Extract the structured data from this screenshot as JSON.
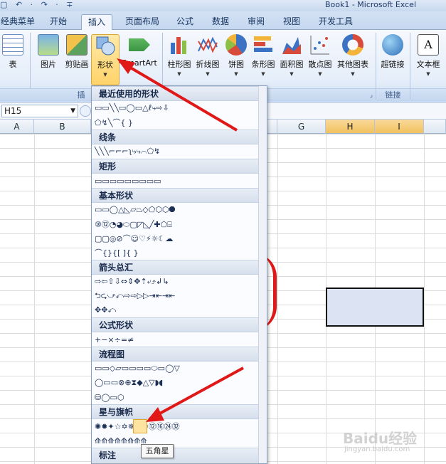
{
  "window": {
    "title": "Book1 - Microsoft Excel",
    "qat": "▢ ↶ · ↷ · ∓"
  },
  "tabs": [
    "经典菜单",
    "开始",
    "插入",
    "页面布局",
    "公式",
    "数据",
    "审阅",
    "视图",
    "开发工具"
  ],
  "ribbon": {
    "buttons": [
      "表",
      "图片",
      "剪贴画",
      "形状",
      "SmartArt",
      "柱形图",
      "折线图",
      "饼图",
      "条形图",
      "面积图",
      "散点图",
      "其他图表",
      "超链接",
      "文本框"
    ],
    "groups": [
      "插",
      "链接"
    ]
  },
  "formula": {
    "namebox": "H15"
  },
  "columns": [
    "A",
    "B",
    "G",
    "H",
    "I"
  ],
  "gallery": {
    "sections": [
      {
        "title": "最近使用的形状",
        "rows": [
          "▭▭╲╲▭◯▭△ℓ⤷⇨⇩",
          "⬠↯╲⌒{ }"
        ]
      },
      {
        "title": "线条",
        "rows": [
          "╲╲╲⌐⌐⌐ʅ⤷⤷⌒⬠↯"
        ]
      },
      {
        "title": "矩形",
        "rows": [
          "▭▭▭▭▭▭▭▭▭"
        ]
      },
      {
        "title": "基本形状",
        "rows": [
          "▭▭◯△◺▱⏢◇⬠⬡⬡⯃",
          "⑩⑫◔◕⬭▢◸◺╱✚⬠⌸",
          "▢▢◎⊘⌒☺♡⚡☼☾☁",
          "⌒{}{[ ]{ }"
        ]
      },
      {
        "title": "箭头总汇",
        "rows": [
          "⇨⇦⇧⇩⇔⇕✥⇡⤶⤴↲↳",
          "⮌⮎⤻⤺⇨⇨▷▷⇥⇤⇥⇤",
          "✥✥⤺"
        ]
      },
      {
        "title": "公式形状",
        "rows": [
          "+−×÷=≠"
        ]
      },
      {
        "title": "流程图",
        "rows": [
          "▭▭◇▱▭▭▭▭⬭▭◯▽",
          "◯▭▭⊗⊕⧗◆△▽◗◖",
          "⛁◯▭⬡"
        ]
      },
      {
        "title": "星与旗帜",
        "rows": [
          "✺✹✦☆✡✵⑧⑩⑫⑯㉔㉜",
          "⟰⟰⟰⟰⟰⟰⟰⟰"
        ]
      },
      {
        "title": "标注",
        "rows": []
      }
    ],
    "tooltip": "五角星"
  },
  "watermark": {
    "logo": "Baidu经验",
    "url": "jingyan.baidu.com"
  },
  "colors": {
    "accent": "#e01818",
    "selected_tab": "#ffd36a",
    "ribbon": "#e5eefa"
  }
}
